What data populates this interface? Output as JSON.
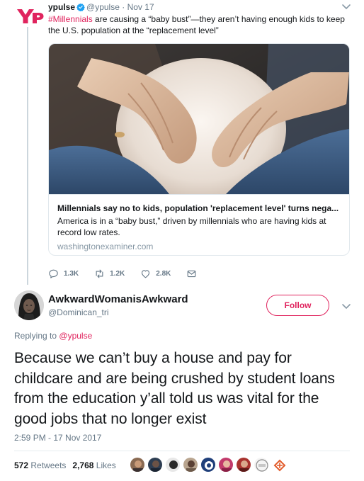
{
  "parent_tweet": {
    "display_name": "ypulse",
    "handle": "@ypulse",
    "date": "Nov 17",
    "logo_text": "YP",
    "hashtag": "#Millennials",
    "text": " are causing a “baby bust”—they aren’t having enough kids to keep the U.S. population at the “replacement level”",
    "card": {
      "title": "Millennials say no to kids, population 'replacement level' turns nega...",
      "description": "America is in a “baby bust,” driven by millennials who are having kids at record low rates.",
      "domain": "washingtonexaminer.com"
    },
    "actions": {
      "replies": "1.3K",
      "retweets": "1.2K",
      "likes": "2.8K"
    }
  },
  "main_tweet": {
    "display_name": "AwkwardWomanisAwkward",
    "handle": "@Dominican_tri",
    "follow_label": "Follow",
    "replying_prefix": "Replying to",
    "replying_handle": "@ypulse",
    "text": "Because we can’t buy a house and pay for childcare and are being crushed by student loans from the education y’all told us was vital for the good jobs that no longer exist",
    "timestamp": "2:59 PM - 17 Nov 2017",
    "retweet_count": "572",
    "retweet_label": "Retweets",
    "like_count": "2,768",
    "like_label": "Likes"
  },
  "icons": {
    "verified": "verified-badge-icon",
    "reply": "reply-icon",
    "retweet": "retweet-icon",
    "like": "heart-icon",
    "dm": "envelope-icon",
    "caret": "chevron-down-icon"
  },
  "colors": {
    "accent": "#e0245e",
    "verified": "#1da1f2",
    "muted": "#657786",
    "border": "#e1e8ed"
  }
}
